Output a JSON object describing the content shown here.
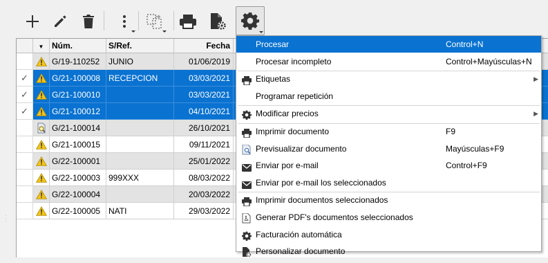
{
  "toolbar": {
    "buttons": [
      {
        "icon": "plus-icon"
      },
      {
        "icon": "pencil-icon"
      },
      {
        "icon": "trash-icon"
      },
      {
        "icon": "more-vertical-icon"
      },
      {
        "icon": "document-copy-icon"
      },
      {
        "icon": "printer-icon"
      },
      {
        "icon": "document-gear-icon"
      },
      {
        "icon": "gear-icon"
      }
    ]
  },
  "grid": {
    "columns": [
      "Núm.",
      "S/Ref.",
      "Fecha"
    ],
    "rows": [
      {
        "num": "G/19-110252",
        "ref": "JUNIO",
        "fecha": "01/06/2019",
        "state": "gray",
        "checked": false,
        "icon": "warning-icon"
      },
      {
        "num": "G/21-100008",
        "ref": "RECEPCION",
        "fecha": "03/03/2021",
        "state": "sel",
        "checked": true,
        "icon": "warning-icon"
      },
      {
        "num": "G/21-100010",
        "ref": "",
        "fecha": "03/03/2021",
        "state": "sel",
        "checked": true,
        "icon": "warning-icon"
      },
      {
        "num": "G/21-100012",
        "ref": "",
        "fecha": "04/10/2021",
        "state": "sel",
        "checked": true,
        "icon": "warning-icon"
      },
      {
        "num": "G/21-100014",
        "ref": "",
        "fecha": "26/10/2021",
        "state": "gray",
        "checked": false,
        "icon": "document-search-icon"
      },
      {
        "num": "G/21-100015",
        "ref": "",
        "fecha": "09/11/2021",
        "state": "white",
        "checked": false,
        "icon": "warning-icon"
      },
      {
        "num": "G/22-100001",
        "ref": "",
        "fecha": "25/01/2022",
        "state": "gray",
        "checked": false,
        "icon": "warning-icon"
      },
      {
        "num": "G/22-100003",
        "ref": "999XXX",
        "fecha": "08/03/2022",
        "state": "white",
        "checked": false,
        "icon": "warning-icon"
      },
      {
        "num": "G/22-100004",
        "ref": "",
        "fecha": "20/03/2022",
        "state": "gray",
        "checked": false,
        "icon": "warning-icon"
      },
      {
        "num": "G/22-100005",
        "ref": "NATI",
        "fecha": "29/03/2022",
        "state": "white",
        "checked": false,
        "icon": "warning-icon"
      }
    ]
  },
  "menu": {
    "items": [
      {
        "label": "Procesar",
        "shortcut": "Control+N",
        "icon": "",
        "submenu": false,
        "active": true
      },
      {
        "label": "Procesar incompleto",
        "shortcut": "Control+Mayúsculas+N",
        "icon": "",
        "submenu": false
      },
      {
        "label": "Etiquetas",
        "shortcut": "",
        "icon": "printer-icon",
        "submenu": true
      },
      {
        "label": "Programar repetición",
        "shortcut": "",
        "icon": "",
        "submenu": false
      },
      {
        "label": "Modificar precios",
        "shortcut": "",
        "icon": "gear-icon",
        "submenu": true
      },
      {
        "label": "Imprimir documento",
        "shortcut": "F9",
        "icon": "printer-icon",
        "submenu": false
      },
      {
        "label": "Previsualizar documento",
        "shortcut": "Mayúsculas+F9",
        "icon": "preview-icon",
        "submenu": false
      },
      {
        "label": "Enviar por e-mail",
        "shortcut": "Control+F9",
        "icon": "envelope-icon",
        "submenu": false
      },
      {
        "label": "Enviar por e-mail los seleccionados",
        "shortcut": "",
        "icon": "envelope-icon",
        "submenu": false
      },
      {
        "label": "Imprimir documentos seleccionados",
        "shortcut": "",
        "icon": "printer-icon",
        "submenu": false
      },
      {
        "label": "Generar PDF's documentos seleccionados",
        "shortcut": "",
        "icon": "pdf-icon",
        "submenu": false
      },
      {
        "label": "Facturación automática",
        "shortcut": "",
        "icon": "gear-icon",
        "submenu": false
      },
      {
        "label": "Personalizar documento",
        "shortcut": "",
        "icon": "document-gear-icon",
        "submenu": false
      }
    ]
  },
  "colors": {
    "selection": "#0a72d1",
    "row_gray": "#e3e3e3",
    "warning": "#f3c417"
  }
}
